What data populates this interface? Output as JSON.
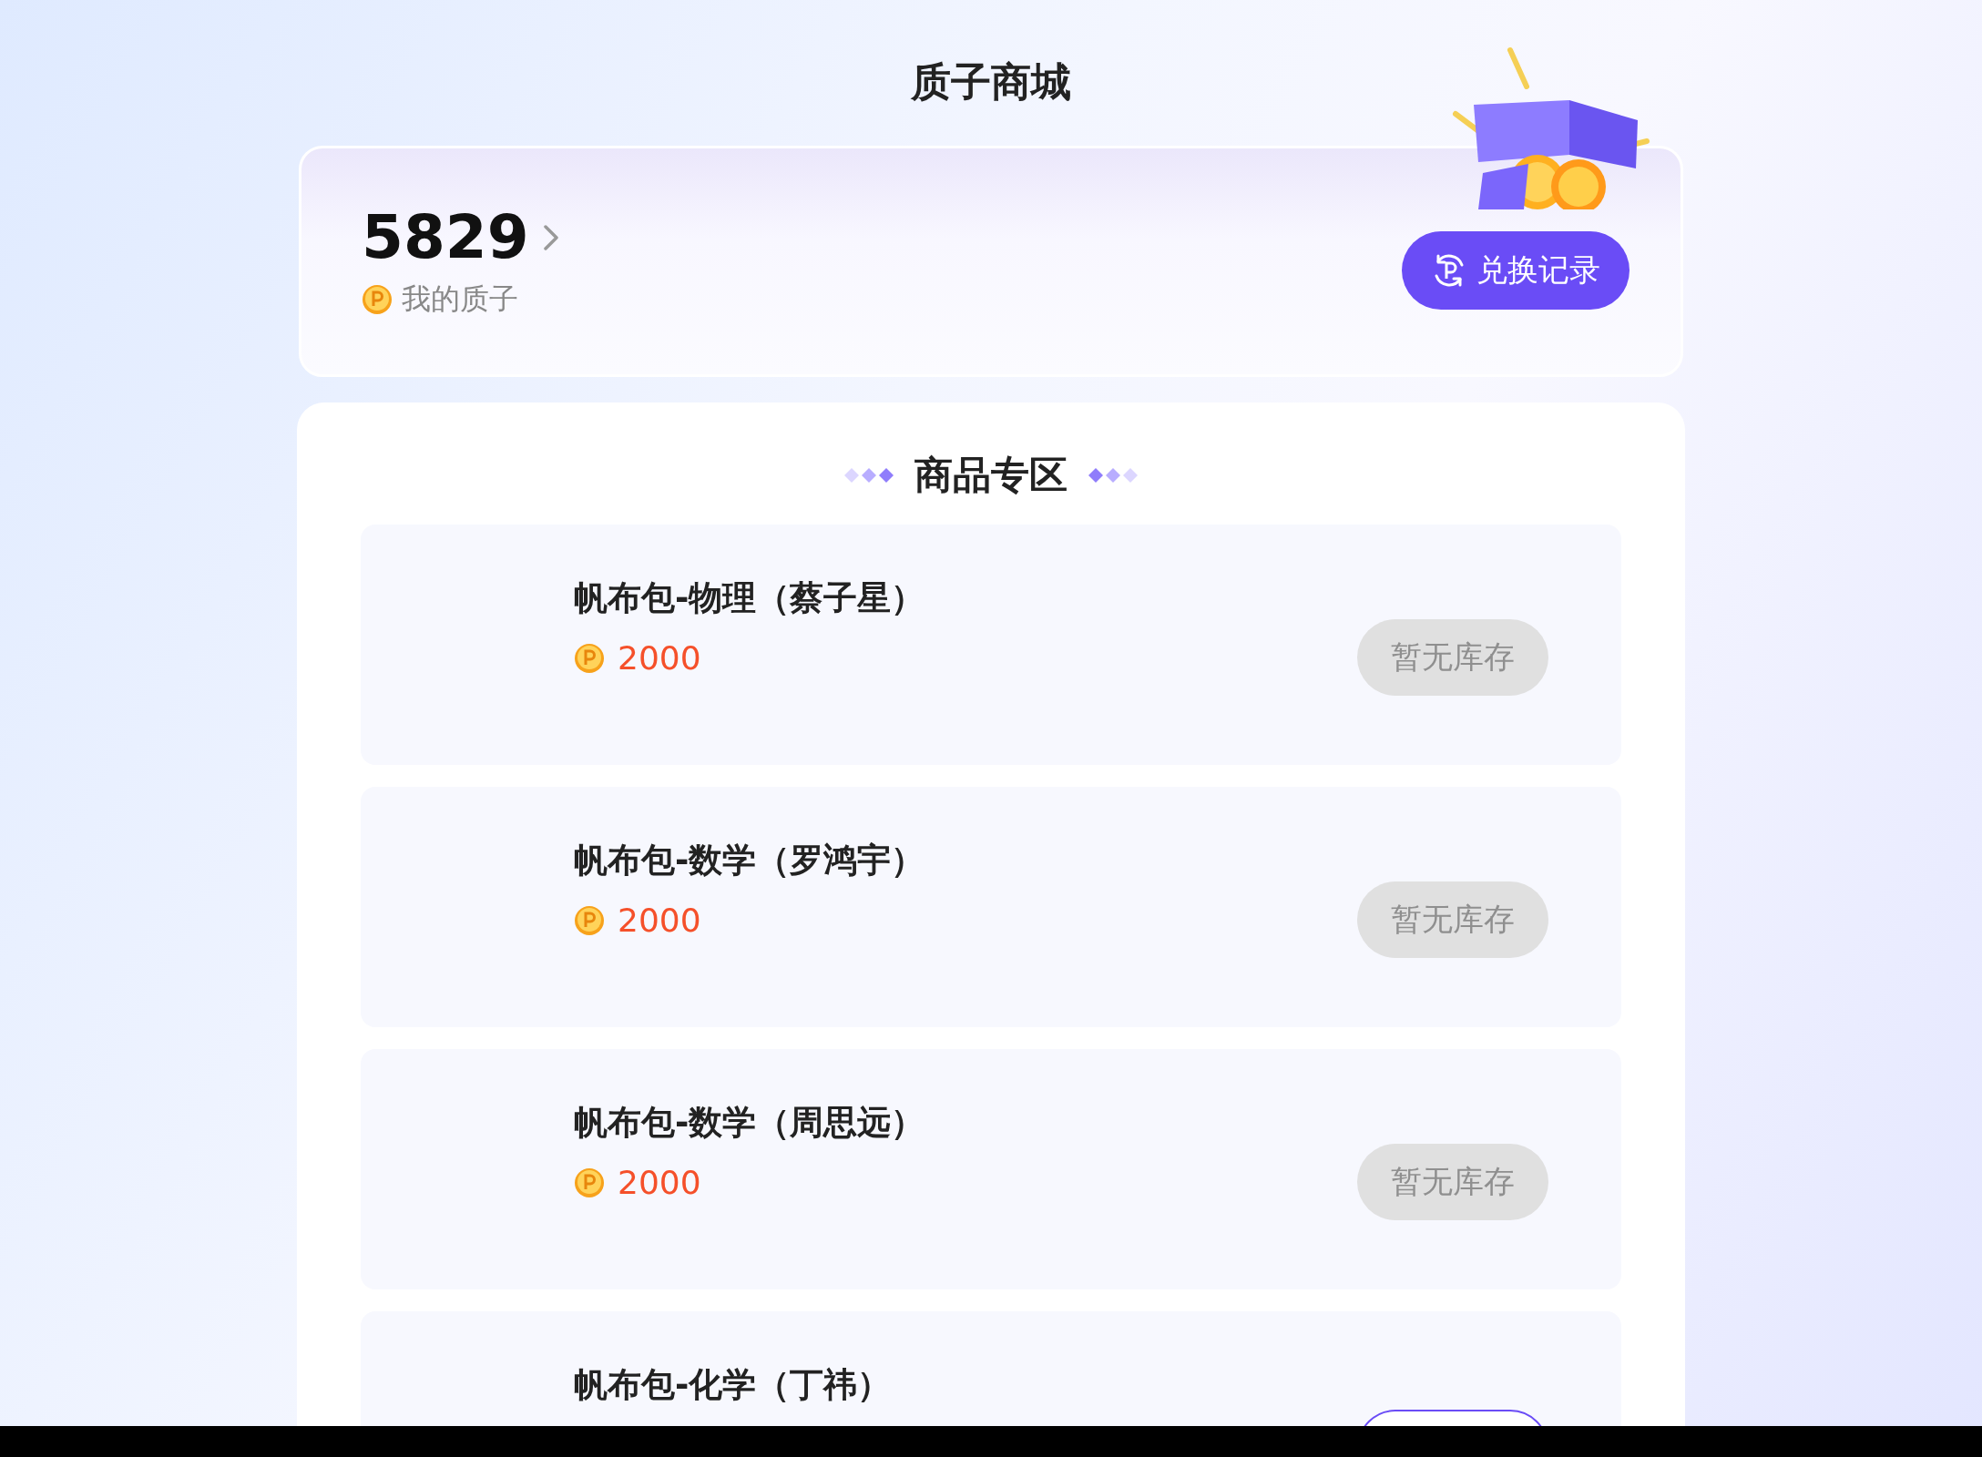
{
  "page": {
    "title": "质子商城"
  },
  "balance": {
    "amount": "5829",
    "label": "我的质子"
  },
  "history_button": {
    "label": "兑换记录"
  },
  "section": {
    "title": "商品专区"
  },
  "products": [
    {
      "name": "帆布包-物理（蔡子星）",
      "price": "2000",
      "in_stock": false,
      "button_label": "暂无库存"
    },
    {
      "name": "帆布包-数学（罗鸿宇）",
      "price": "2000",
      "in_stock": false,
      "button_label": "暂无库存"
    },
    {
      "name": "帆布包-数学（周思远）",
      "price": "2000",
      "in_stock": false,
      "button_label": "暂无库存"
    },
    {
      "name": "帆布包-化学（丁祎）",
      "in_stock": true
    }
  ]
}
